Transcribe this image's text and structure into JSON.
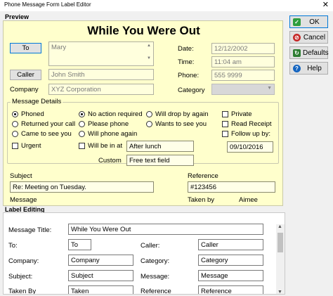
{
  "window": {
    "title": "Phone Message Form Label Editor",
    "close": "✕"
  },
  "preview": {
    "group_label": "Preview",
    "title": "While You Were Out",
    "to_button": "To",
    "to_value": "Mary",
    "caller_button": "Caller",
    "caller_value": "John Smith",
    "company_label": "Company",
    "company_value": "XYZ Corporation",
    "date_label": "Date:",
    "date_value": "12/12/2002",
    "time_label": "Time:",
    "time_value": "11:04 am",
    "phone_label": "Phone:",
    "phone_value": "555 9999",
    "category_label": "Category",
    "category_value": "",
    "details_label": "Message Details",
    "radios_col1": [
      "Phoned",
      "Returned your call",
      "Came to see you"
    ],
    "radios_col2": [
      "No action required",
      "Please phone",
      "Will phone again"
    ],
    "radios_col3": [
      "Will drop by again",
      "Wants to see you"
    ],
    "checks_col4": [
      "Private",
      "Read Receipt",
      "Follow up by:"
    ],
    "follow_up_date": "09/10/2016",
    "urgent_label": "Urgent",
    "will_be_in_label": "Will be in at",
    "will_be_in_value": "After lunch",
    "custom_label": "Custom",
    "custom_value": "Free text field",
    "subject_label": "Subject",
    "subject_value": "Re: Meeting on Tuesday.",
    "reference_label": "Reference",
    "reference_value": "#123456",
    "message_label": "Message",
    "taken_by_label": "Taken by",
    "taken_by_value": "Aimee"
  },
  "buttons": {
    "ok": "OK",
    "cancel": "Cancel",
    "defaults": "Defaults",
    "help": "Help"
  },
  "label_editing": {
    "group_label": "Label Editing",
    "message_title_label": "Message Title:",
    "message_title_value": "While You Were Out",
    "to_label": "To:",
    "to_value": "To",
    "caller_label": "Caller:",
    "caller_value": "Caller",
    "company_label": "Company:",
    "company_value": "Company",
    "category_label": "Category:",
    "category_value": "Category",
    "subject_label": "Subject:",
    "subject_value": "Subject",
    "message_label": "Message:",
    "message_value": "Message",
    "partial_label": "Taken By",
    "partial_value": "Taken",
    "partial_label_2": "Reference",
    "partial_value_2": "Reference"
  },
  "colors": {
    "preview_bg": "#ffffcc",
    "ok_icon": "#2e9e3e",
    "cancel_icon": "#c62828",
    "defaults_icon": "#2e7d32",
    "help_icon": "#1565c0"
  }
}
